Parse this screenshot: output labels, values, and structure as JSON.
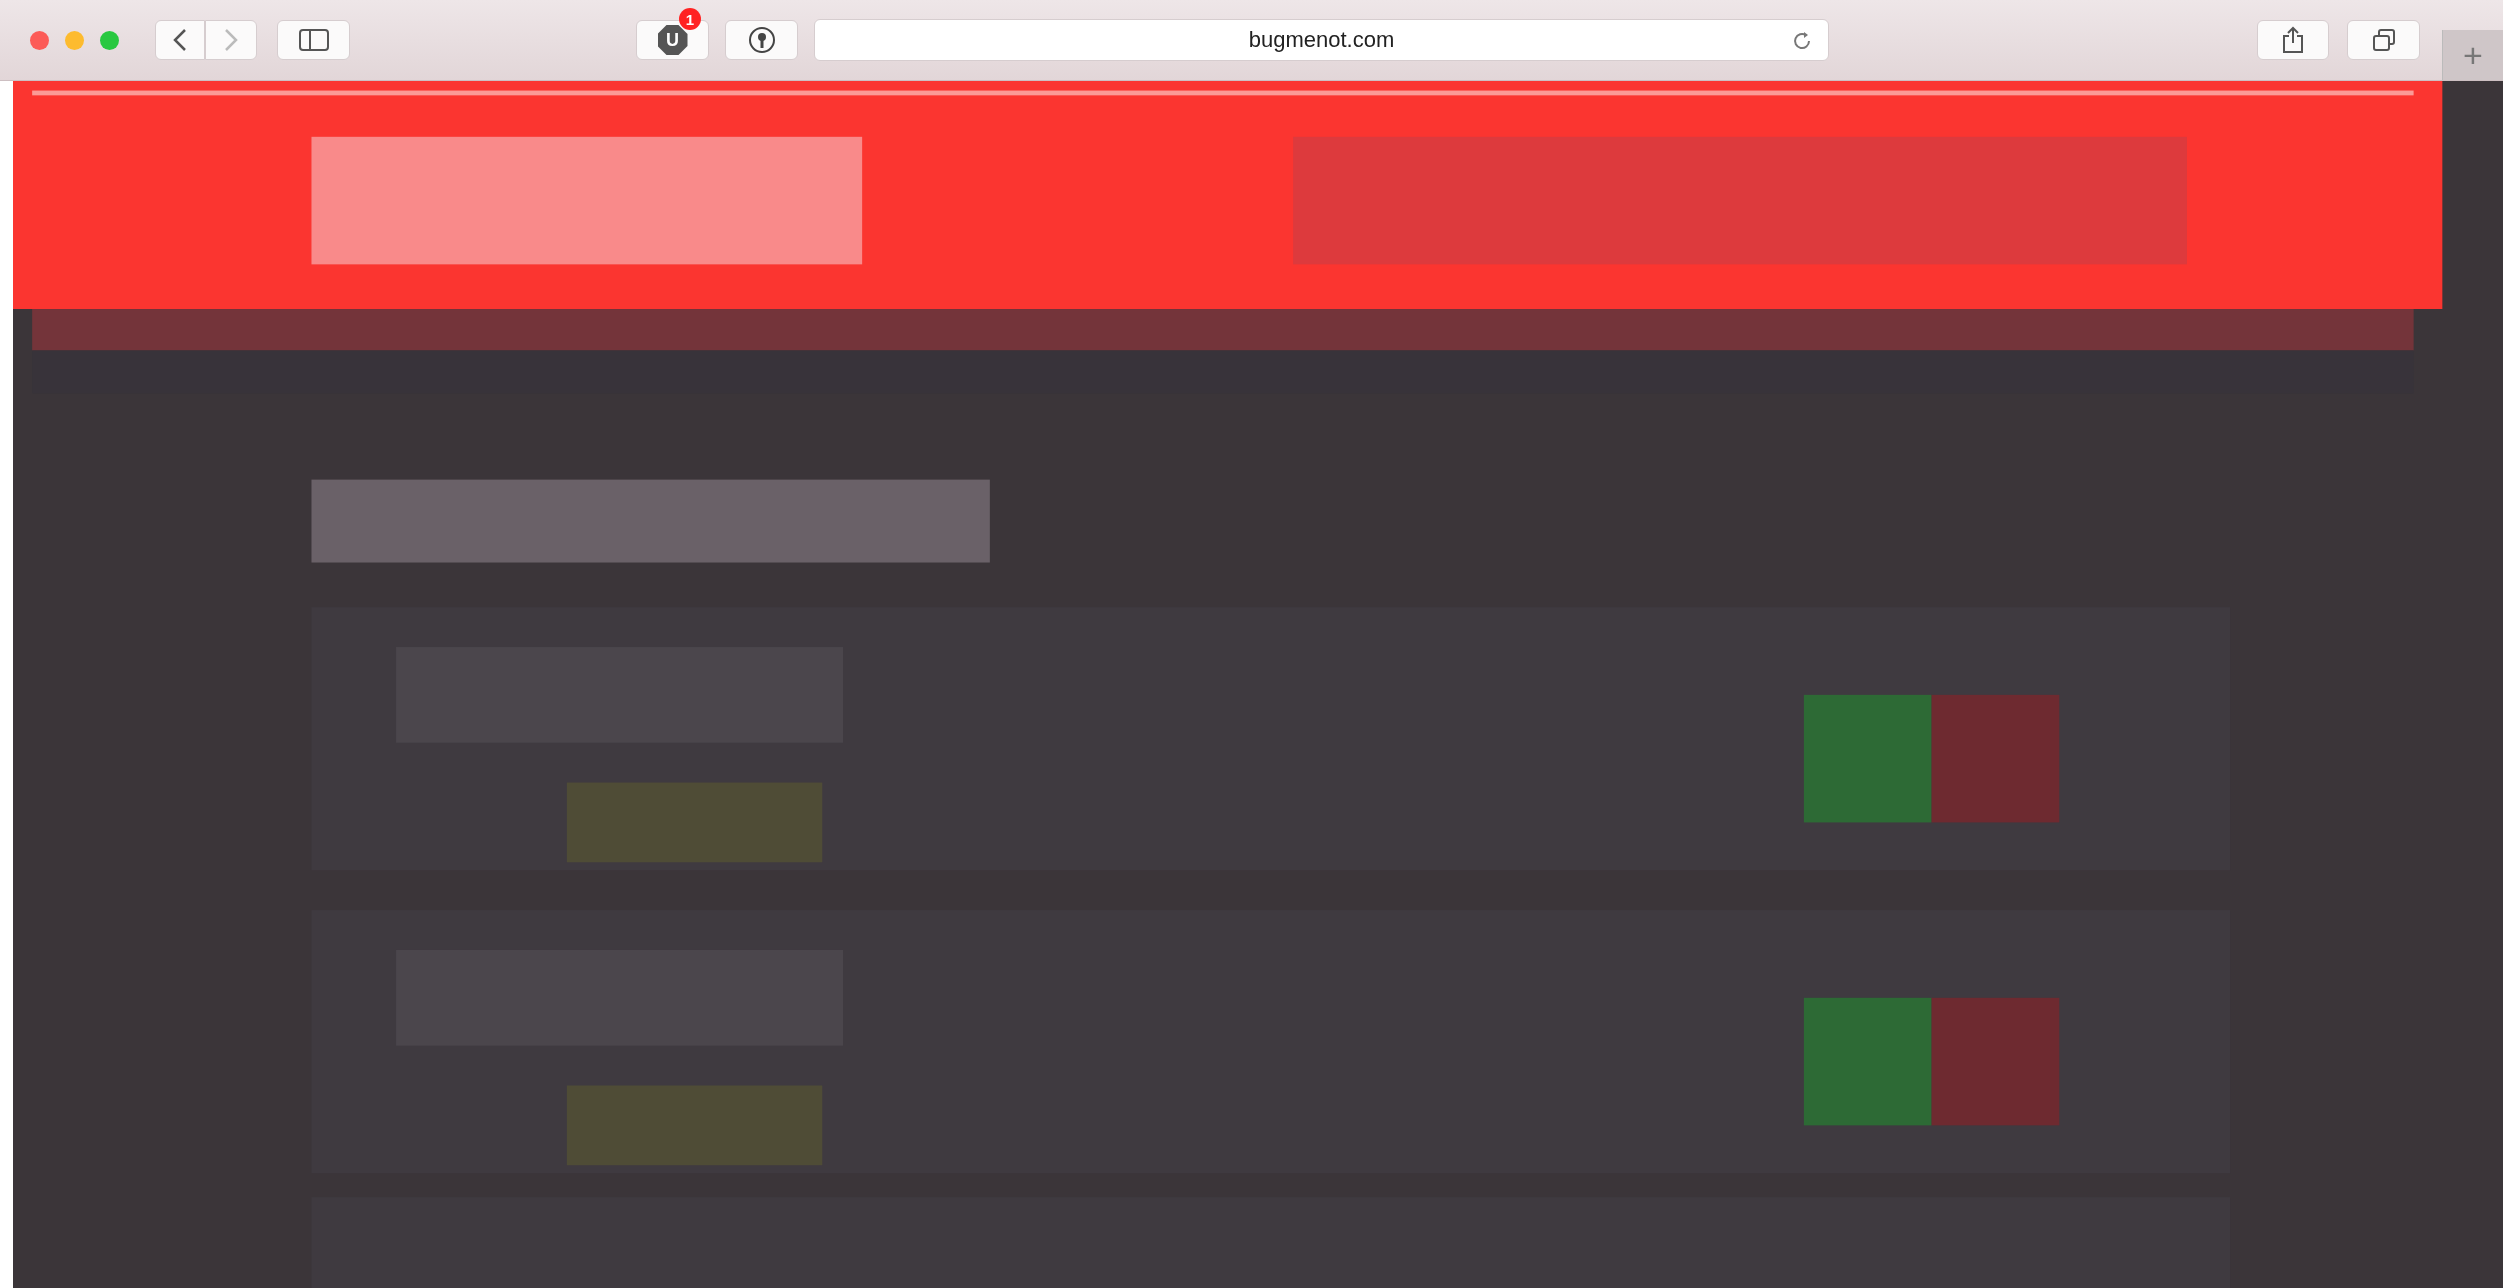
{
  "toolbar": {
    "extension": {
      "letter": "U",
      "count": "1"
    },
    "address": "bugmenot.com"
  },
  "new_tab": "+"
}
